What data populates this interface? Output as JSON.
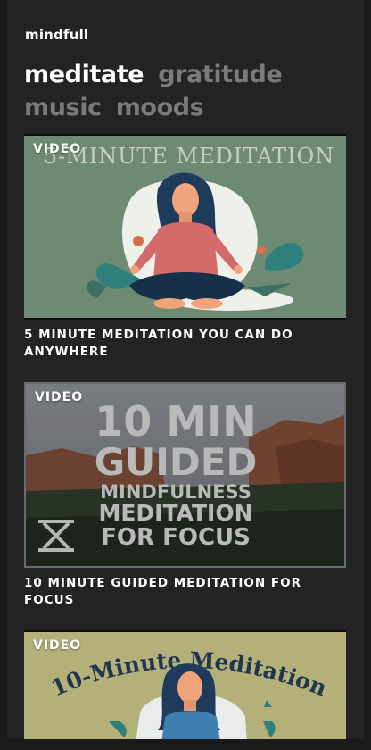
{
  "app": {
    "brand": "mindfull"
  },
  "tabs": [
    {
      "label": "meditate",
      "active": true
    },
    {
      "label": "gratitude",
      "active": false
    },
    {
      "label": "music",
      "active": false
    },
    {
      "label": "moods",
      "active": false
    }
  ],
  "cards": [
    {
      "badge": "VIDEO",
      "thumb_title": "5-MINUTE MEDITATION",
      "caption": "5 MINUTE MEDITATION YOU CAN DO ANYWHERE"
    },
    {
      "badge": "VIDEO",
      "thumb_lines": [
        "10 MIN",
        "GUIDED",
        "MINDFULNESS",
        "MEDITATION",
        "FOR FOCUS"
      ],
      "caption": "10 MINUTE GUIDED MEDITATION FOR FOCUS"
    },
    {
      "badge": "VIDEO",
      "thumb_title": "10-Minute Meditation"
    }
  ],
  "colors": {
    "background": "#232323",
    "active_tab": "#ffffff",
    "inactive_tab": "#7a7a7a",
    "thumb1_bg": "#6e8a72",
    "thumb3_bg": "#b3b07a"
  }
}
